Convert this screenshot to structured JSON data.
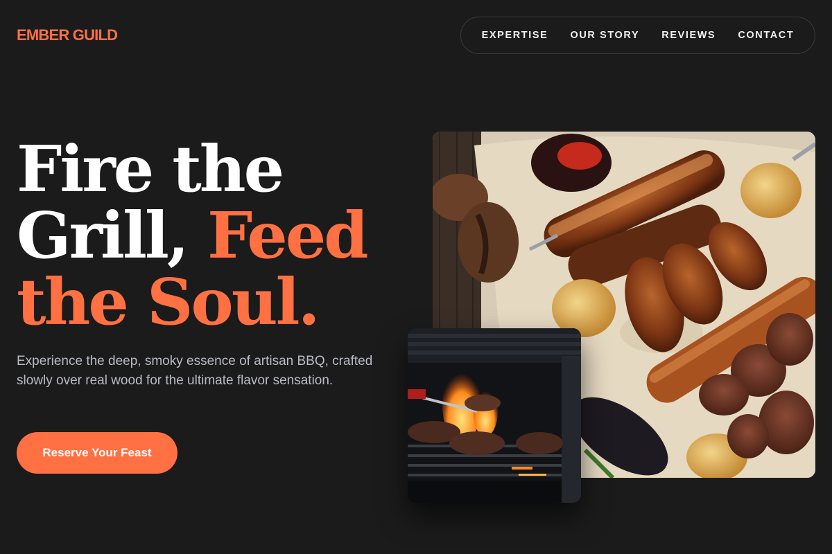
{
  "brand": {
    "logo": "EMBER GUILD",
    "accent_color": "#ff7043"
  },
  "nav": {
    "items": [
      {
        "label": "EXPERTISE"
      },
      {
        "label": "OUR STORY"
      },
      {
        "label": "REVIEWS"
      },
      {
        "label": "CONTACT"
      }
    ]
  },
  "hero": {
    "title_white": "Fire the Grill,",
    "title_line1": "Fire the",
    "title_line2_white": "Grill, ",
    "title_line2_accent": "Feed",
    "title_line3_accent": "the Soul.",
    "subtitle": "Experience the deep, smoky essence of artisan BBQ, crafted slowly over real wood for the ultimate flavor sensation.",
    "cta_label": "Reserve Your Feast"
  },
  "images": {
    "main": "bbq-platter-photo",
    "secondary": "grill-flames-photo"
  }
}
